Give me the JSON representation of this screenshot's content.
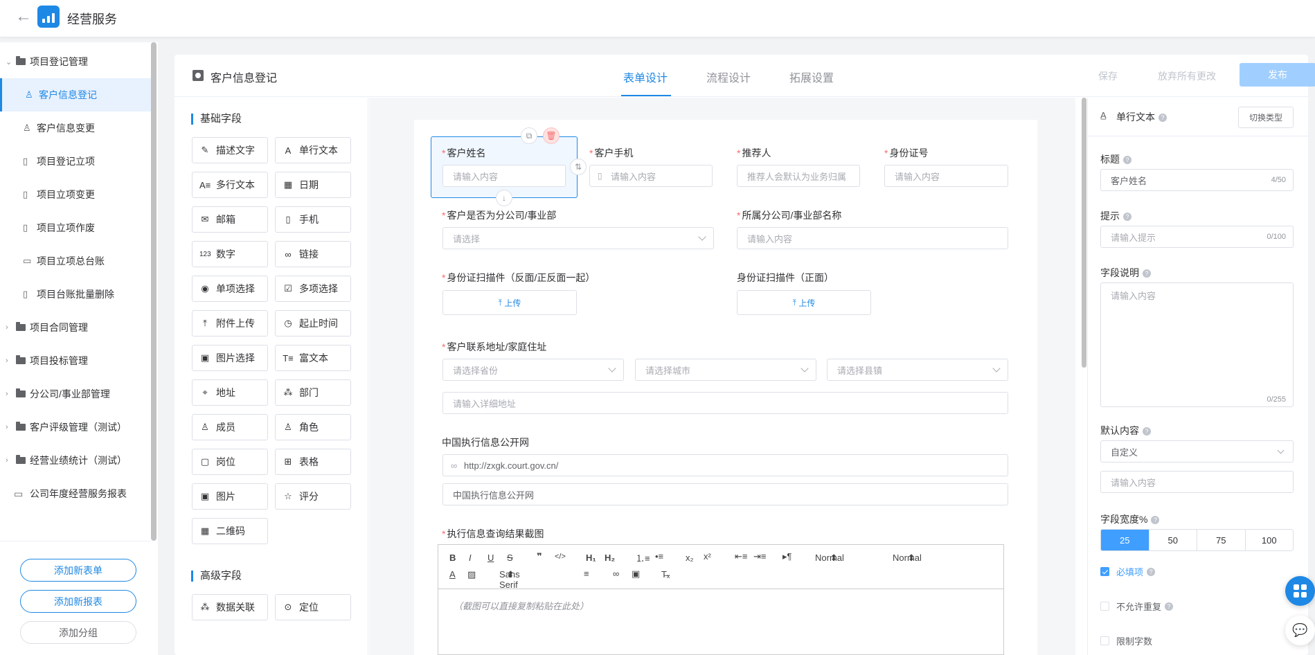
{
  "app": {
    "title": "经营服务"
  },
  "sidebar": {
    "groups": [
      {
        "label": "项目登记管理",
        "expanded": true
      },
      {
        "label": "项目合同管理"
      },
      {
        "label": "项目投标管理"
      },
      {
        "label": "分公司/事业部管理"
      },
      {
        "label": "客户评级管理（测试）"
      },
      {
        "label": "经营业绩统计（测试）"
      },
      {
        "label": "公司年度经营服务报表"
      }
    ],
    "items": [
      {
        "label": "客户信息登记",
        "icon": "user-icon",
        "active": true
      },
      {
        "label": "客户信息变更",
        "icon": "user-icon"
      },
      {
        "label": "项目登记立项",
        "icon": "doc-icon"
      },
      {
        "label": "项目立项变更",
        "icon": "doc-edit-icon"
      },
      {
        "label": "项目立项作废",
        "icon": "doc-edit-icon"
      },
      {
        "label": "项目立项总台账",
        "icon": "monitor-icon"
      },
      {
        "label": "项目台账批量删除",
        "icon": "doc-edit-icon"
      }
    ],
    "buttons": {
      "add_form": "添加新表单",
      "add_report": "添加新报表",
      "add_group": "添加分组"
    }
  },
  "header": {
    "form_title": "客户信息登记",
    "tabs": [
      "表单设计",
      "流程设计",
      "拓展设置"
    ],
    "active_tab": "表单设计",
    "save": "保存",
    "discard": "放弃所有更改",
    "publish": "发布"
  },
  "palette": {
    "basic_title": "基础字段",
    "basic": [
      {
        "label": "描述文字",
        "icon": "pen-icon"
      },
      {
        "label": "单行文本",
        "icon": "text-a-icon"
      },
      {
        "label": "多行文本",
        "icon": "multiline-icon"
      },
      {
        "label": "日期",
        "icon": "calendar-icon"
      },
      {
        "label": "邮箱",
        "icon": "mail-icon"
      },
      {
        "label": "手机",
        "icon": "phone-icon"
      },
      {
        "label": "数字",
        "icon": "number-icon"
      },
      {
        "label": "链接",
        "icon": "link-icon"
      },
      {
        "label": "单项选择",
        "icon": "radio-icon"
      },
      {
        "label": "多项选择",
        "icon": "checkbox-icon"
      },
      {
        "label": "附件上传",
        "icon": "upload-icon"
      },
      {
        "label": "起止时间",
        "icon": "clock-icon"
      },
      {
        "label": "图片选择",
        "icon": "image-icon"
      },
      {
        "label": "富文本",
        "icon": "richtext-icon"
      },
      {
        "label": "地址",
        "icon": "location-icon"
      },
      {
        "label": "部门",
        "icon": "org-icon"
      },
      {
        "label": "成员",
        "icon": "member-icon"
      },
      {
        "label": "角色",
        "icon": "role-icon"
      },
      {
        "label": "岗位",
        "icon": "badge-icon"
      },
      {
        "label": "表格",
        "icon": "table-icon"
      },
      {
        "label": "图片",
        "icon": "picture-icon"
      },
      {
        "label": "评分",
        "icon": "star-icon"
      },
      {
        "label": "二维码",
        "icon": "qrcode-icon"
      }
    ],
    "advanced_title": "高级字段",
    "advanced": [
      {
        "label": "数据关联",
        "icon": "relation-icon"
      },
      {
        "label": "定位",
        "icon": "target-icon"
      }
    ]
  },
  "form": {
    "customer_name": {
      "label": "客户姓名",
      "placeholder": "请输入内容"
    },
    "customer_phone": {
      "label": "客户手机",
      "placeholder": "请输入内容"
    },
    "referrer": {
      "label": "推荐人",
      "placeholder": "推荐人会默认为业务归属"
    },
    "id_number": {
      "label": "身份证号",
      "placeholder": "请输入内容"
    },
    "is_branch": {
      "label": "客户是否为分公司/事业部",
      "placeholder": "请选择"
    },
    "branch_name": {
      "label": "所属分公司/事业部名称",
      "placeholder": "请输入内容"
    },
    "id_scan_both": {
      "label": "身份证扫描件（反面/正反面一起）",
      "button": "上传"
    },
    "id_scan_front": {
      "label": "身份证扫描件（正面）",
      "button": "上传"
    },
    "address": {
      "label": "客户联系地址/家庭住址",
      "province": "请选择省份",
      "city": "请选择城市",
      "county": "请选择县镇",
      "detail": "请输入详细地址"
    },
    "court": {
      "label": "中国执行信息公开网",
      "url": "http://zxgk.court.gov.cn/",
      "text": "中国执行信息公开网"
    },
    "screenshot": {
      "label": "执行信息查询结果截图",
      "placeholder": "（截图可以直接复制粘贴在此处）",
      "toolbar": {
        "header1": "Normal",
        "header2": "Normal",
        "font": "Sans Serif"
      }
    }
  },
  "props": {
    "type_label": "单行文本",
    "switch_type": "切换类型",
    "title_label": "标题",
    "title_value": "客户姓名",
    "title_count": "4/50",
    "hint_label": "提示",
    "hint_placeholder": "请输入提示",
    "hint_count": "0/100",
    "desc_label": "字段说明",
    "desc_placeholder": "请输入内容",
    "desc_count": "0/255",
    "default_label": "默认内容",
    "default_mode": "自定义",
    "default_placeholder": "请输入内容",
    "width_label": "字段宽度%",
    "width_options": [
      "25",
      "50",
      "75",
      "100"
    ],
    "width_selected": "25",
    "required": {
      "label": "必填项",
      "checked": true
    },
    "no_duplicate": {
      "label": "不允许重复",
      "checked": false
    },
    "limit_chars": {
      "label": "限制字数",
      "checked": false
    }
  },
  "colors": {
    "accent": "#1e88e5",
    "required": "#f56c6c",
    "publish_disabled": "#a0cfff"
  }
}
